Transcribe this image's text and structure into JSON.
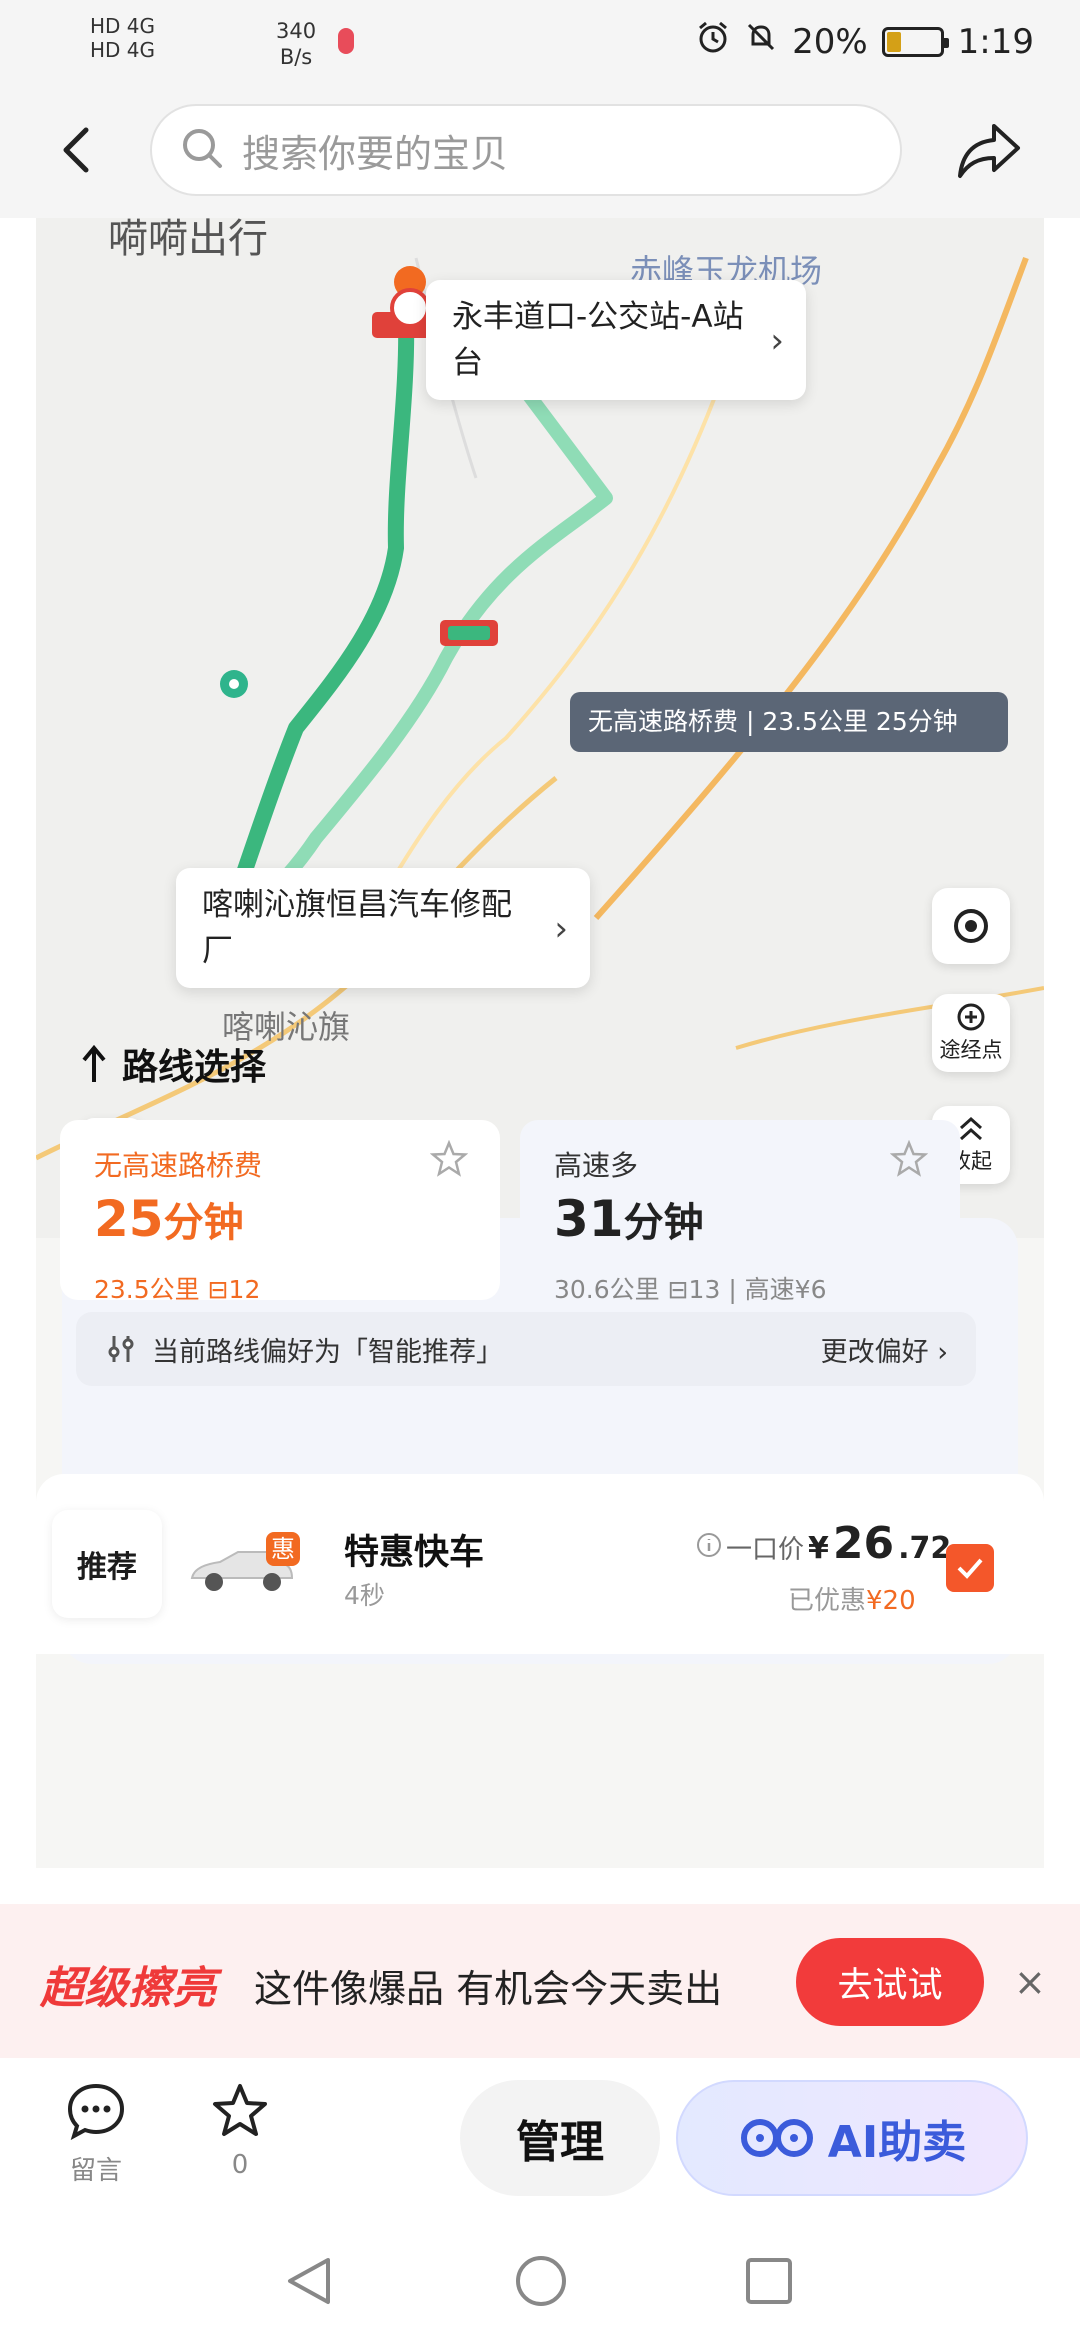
{
  "status_bar": {
    "sim1": "HD 4G",
    "sim2": "HD 4G",
    "net_speed": "340",
    "net_unit": "B/s",
    "battery": "20%",
    "time": "1:19"
  },
  "top_nav": {
    "search_placeholder": "搜索你要的宝贝"
  },
  "map": {
    "hidden_title": "嗬嗬出行",
    "airport_label": "赤峰玉龙机场",
    "destination_card": "永丰道口-公交站-A站台",
    "origin_card": "喀喇沁旗恒昌汽车修配厂",
    "town_label": "喀喇沁旗",
    "route_tip": "无高速路桥费 | 23.5公里 25分钟",
    "fab_waypoint": "途经点",
    "fab_collapse": "收起"
  },
  "route_panel": {
    "title": "路线选择",
    "options": [
      {
        "tag": "无高速路桥费",
        "time_num": "25",
        "time_unit": "分钟",
        "meta": "23.5公里 ⊟12"
      },
      {
        "tag": "高速多",
        "time_num": "31",
        "time_unit": "分钟",
        "meta": "30.6公里 ⊟13 | 高速¥6"
      }
    ],
    "preference_text": "当前路线偏好为「智能推荐」",
    "change_preference": "更改偏好 ›",
    "colors": {
      "accent": "#f26a21",
      "route_primary": "#3bb77e",
      "route_alt": "#8fdcb6"
    }
  },
  "order": {
    "rec_tab": "推荐",
    "badge": "惠",
    "car_name": "特惠快车",
    "car_sub": "4秒",
    "price_label": "一口价",
    "price_symbol": "¥",
    "price_int": "26",
    "price_dec": ".72",
    "discount_label": "已优惠",
    "discount_amount": "¥20"
  },
  "promo": {
    "brand": "超级擦亮",
    "text": "这件像爆品 有机会今天卖出",
    "button": "去试试",
    "close": "×"
  },
  "action_bar": {
    "comment_label": "留言",
    "favorite_count": "0",
    "manage": "管理",
    "ai_sell": "AI助卖"
  }
}
